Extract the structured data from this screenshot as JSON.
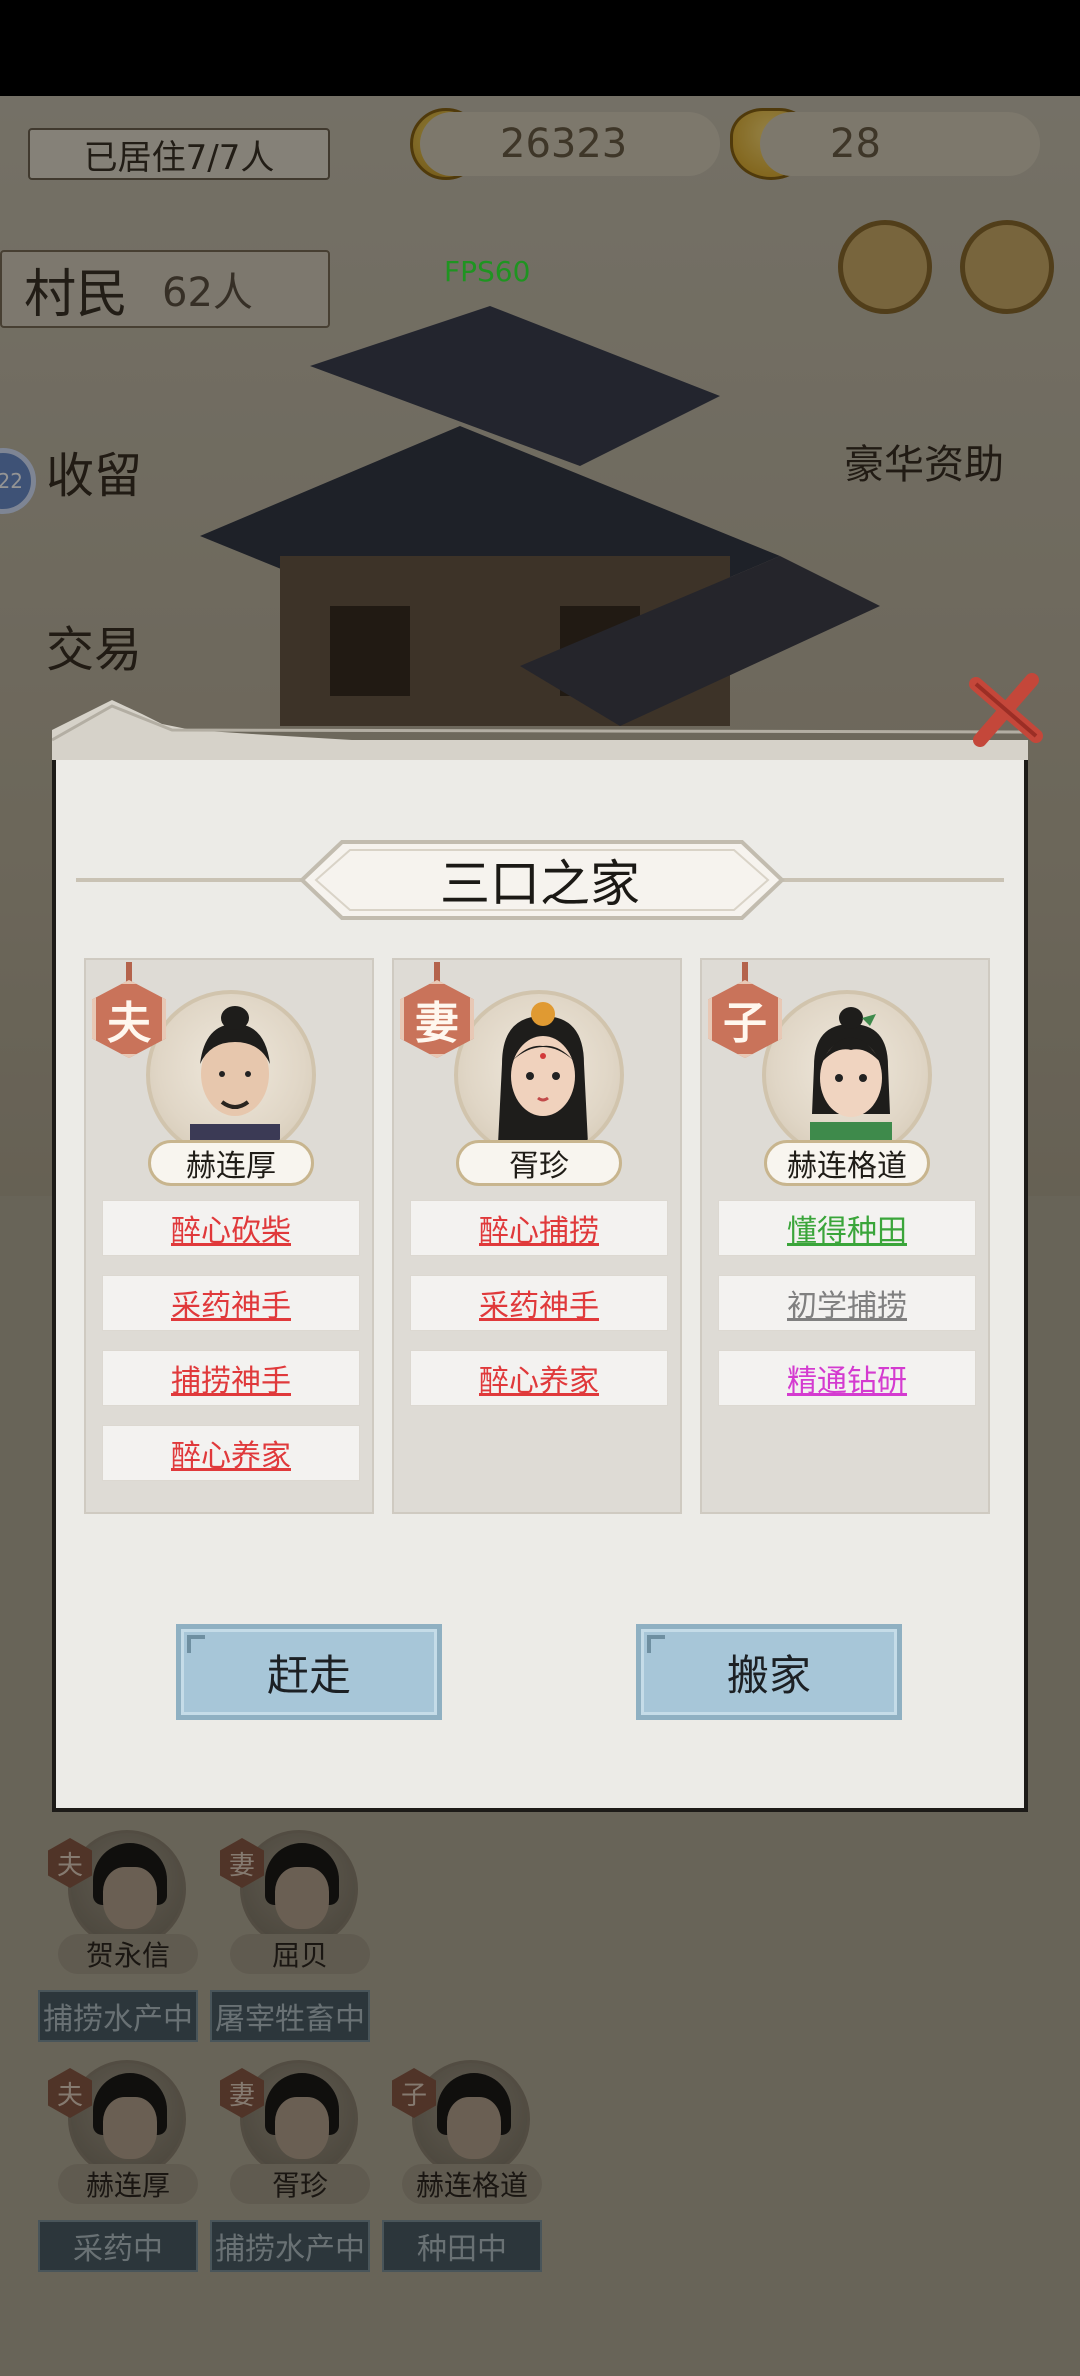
{
  "hud": {
    "resident_label": "已居住7/7人",
    "coins": "26323",
    "ingots": "28",
    "villager_label": "村民",
    "villager_count": "62人",
    "fps": "FPS60",
    "left_circle_text": "22",
    "side_left_1": "收留",
    "side_left_2": "交易",
    "side_right_1": "豪华资助"
  },
  "dialog": {
    "title": "三口之家",
    "members": [
      {
        "role": "夫",
        "name": "赫连厚",
        "traits": [
          {
            "label": "醉心砍柴",
            "color": "#e0393b"
          },
          {
            "label": "采药神手",
            "color": "#e0393b"
          },
          {
            "label": "捕捞神手",
            "color": "#e0393b"
          },
          {
            "label": "醉心养家",
            "color": "#e0393b"
          }
        ]
      },
      {
        "role": "妻",
        "name": "胥珍",
        "traits": [
          {
            "label": "醉心捕捞",
            "color": "#e0393b"
          },
          {
            "label": "采药神手",
            "color": "#e0393b"
          },
          {
            "label": "醉心养家",
            "color": "#e0393b"
          }
        ]
      },
      {
        "role": "子",
        "name": "赫连格道",
        "traits": [
          {
            "label": "懂得种田",
            "color": "#3aa53a"
          },
          {
            "label": "初学捕捞",
            "color": "#808080"
          },
          {
            "label": "精通钻研",
            "color": "#d43bd0"
          }
        ]
      }
    ],
    "evict_label": "赶走",
    "move_label": "搬家"
  },
  "background_families": [
    {
      "role": "夫",
      "name": "贺永信",
      "status": "捕捞水产中"
    },
    {
      "role": "妻",
      "name": "屈贝",
      "status": "屠宰牲畜中"
    },
    {
      "role": "夫",
      "name": "赫连厚",
      "status": "采药中"
    },
    {
      "role": "妻",
      "name": "胥珍",
      "status": "捕捞水产中"
    },
    {
      "role": "子",
      "name": "赫连格道",
      "status": "种田中"
    }
  ]
}
